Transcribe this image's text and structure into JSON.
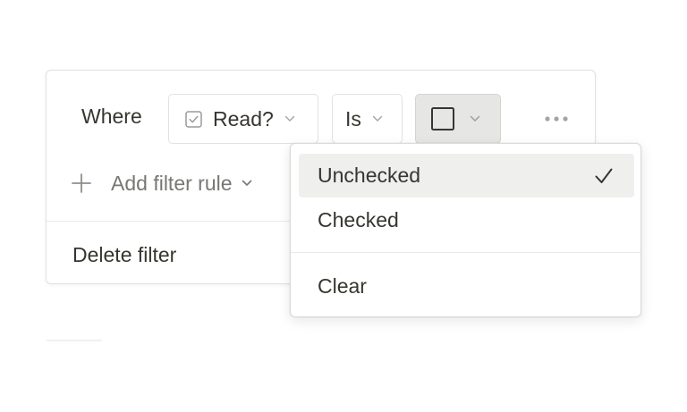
{
  "filter": {
    "where_label": "Where",
    "property": {
      "icon": "checkbox-property-icon",
      "label": "Read?"
    },
    "operator": {
      "label": "Is"
    },
    "value": {
      "icon": "empty-checkbox-icon",
      "state": "unchecked"
    },
    "more_icon": "more-horizontal-icon",
    "add_rule_label": "Add filter rule",
    "delete_label": "Delete filter"
  },
  "dropdown": {
    "options": [
      {
        "label": "Unchecked",
        "selected": true
      },
      {
        "label": "Checked",
        "selected": false
      }
    ],
    "clear_label": "Clear",
    "selected_marker": "checkmark-icon"
  },
  "colors": {
    "text": "#37352f",
    "muted_text": "#787774",
    "border": "#e3e2e0",
    "selected_bg": "#efefee",
    "value_chip_bg": "#e6e6e4"
  }
}
